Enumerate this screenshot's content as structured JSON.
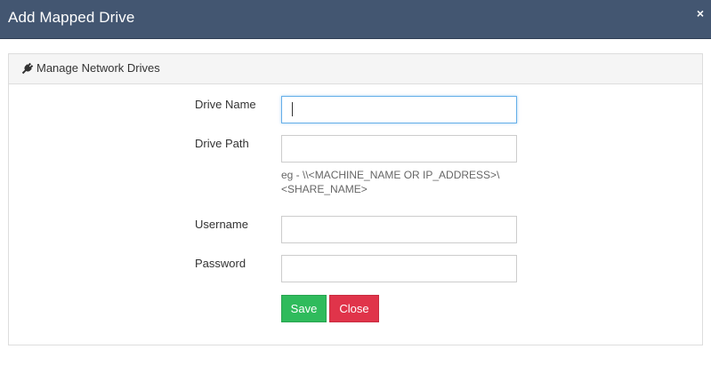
{
  "dialog": {
    "title": "Add Mapped Drive",
    "close_glyph": "×"
  },
  "panel": {
    "heading": "Manage Network Drives",
    "heading_icon": "plug-icon"
  },
  "form": {
    "drive_name": {
      "label": "Drive Name",
      "value": ""
    },
    "drive_path": {
      "label": "Drive Path",
      "value": "",
      "hint": "eg - \\\\<MACHINE_NAME OR IP_ADDRESS>\\<SHARE_NAME>"
    },
    "username": {
      "label": "Username",
      "value": ""
    },
    "password": {
      "label": "Password",
      "value": ""
    }
  },
  "buttons": {
    "save_label": "Save",
    "close_label": "Close"
  },
  "colors": {
    "titlebar": "#435671",
    "save": "#2fbb5c",
    "close": "#e0344a",
    "focus_border": "#66afe9"
  }
}
